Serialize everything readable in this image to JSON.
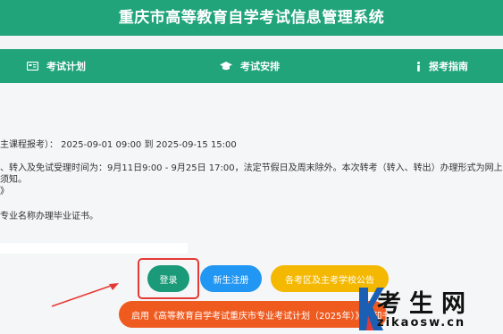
{
  "header": {
    "title": "重庆市高等教育自学考试信息管理系统"
  },
  "nav": {
    "items": [
      {
        "label": "考试计划",
        "icon": "calendar-icon"
      },
      {
        "label": "考试安排",
        "icon": "graduation-cap-icon"
      },
      {
        "label": "报考指南",
        "icon": "info-icon"
      }
    ]
  },
  "notice": {
    "line1": "主课程报考）：  2025-09-01 09:00   到   2025-09-15 15:00",
    "line2": "、转入及免试受理时间为：9月11日9:00 - 9月25日 17:00，法定节假日及周末除外。本次转考（转入、转出）办理形式为网上",
    "line3": "须知。",
    "line4": "》",
    "line5": "专业名称办理毕业证书。"
  },
  "buttons": {
    "login": "登录",
    "register": "新生注册",
    "school_notice": "各考区及主考学校公告",
    "plan": "启用《高等教育自学考试重庆市专业考试计划（2025年）》告知书"
  },
  "watermark": {
    "main": "考生网",
    "sub": "zikaosw.cn"
  },
  "colors": {
    "brand_green": "#21a47a",
    "login_button": "#1a9a78",
    "register_button": "#2196f3",
    "notice_button": "#f5b800",
    "plan_button": "#ef5a1f",
    "highlight": "#e53935"
  }
}
